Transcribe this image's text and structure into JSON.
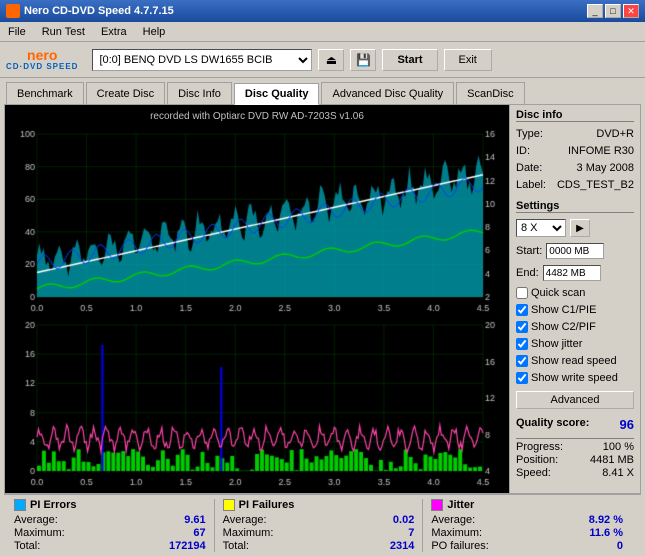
{
  "titlebar": {
    "title": "Nero CD-DVD Speed 4.7.7.15",
    "buttons": [
      "_",
      "□",
      "✕"
    ]
  },
  "menubar": {
    "items": [
      "File",
      "Run Test",
      "Extra",
      "Help"
    ]
  },
  "toolbar": {
    "logo_nero": "nero",
    "logo_sub": "CD·DVD SPEED",
    "drive_label": "[0:0]  BENQ DVD LS DW1655 BCIB",
    "start_label": "Start",
    "exit_label": "Exit"
  },
  "tabs": {
    "items": [
      "Benchmark",
      "Create Disc",
      "Disc Info",
      "Disc Quality",
      "Advanced Disc Quality",
      "ScanDisc"
    ],
    "active": "Disc Quality"
  },
  "chart": {
    "recorded_label": "recorded with Optiarc DVD RW AD-7203S v1.06",
    "top_y_max": "100",
    "top_y_mid": "80",
    "top_y_60": "60",
    "top_y_40": "40",
    "top_y_20": "20",
    "bottom_y_20": "20",
    "bottom_y_16": "16",
    "bottom_y_12": "12",
    "bottom_y_8": "8",
    "bottom_y_4": "4",
    "x_labels": [
      "0.0",
      "0.5",
      "1.0",
      "1.5",
      "2.0",
      "2.5",
      "3.0",
      "3.5",
      "4.0",
      "4.5"
    ],
    "right_y_top": [
      "16",
      "14",
      "12",
      "10",
      "8",
      "6",
      "4",
      "2"
    ],
    "right_y_bottom": [
      "20",
      "16",
      "12",
      "8",
      "4"
    ]
  },
  "disc_info": {
    "section_title": "Disc info",
    "type_label": "Type:",
    "type_value": "DVD+R",
    "id_label": "ID:",
    "id_value": "INFOME R30",
    "date_label": "Date:",
    "date_value": "3 May 2008",
    "label_label": "Label:",
    "label_value": "CDS_TEST_B2"
  },
  "settings": {
    "section_title": "Settings",
    "speed_value": "8 X",
    "start_label": "Start:",
    "start_value": "0000 MB",
    "end_label": "End:",
    "end_value": "4482 MB"
  },
  "checkboxes": {
    "quick_scan": {
      "label": "Quick scan",
      "checked": false
    },
    "show_c1pie": {
      "label": "Show C1/PIE",
      "checked": true
    },
    "show_c2pif": {
      "label": "Show C2/PIF",
      "checked": true
    },
    "show_jitter": {
      "label": "Show jitter",
      "checked": true
    },
    "show_read_speed": {
      "label": "Show read speed",
      "checked": true
    },
    "show_write_speed": {
      "label": "Show write speed",
      "checked": true
    }
  },
  "advanced_btn": "Advanced",
  "quality": {
    "label": "Quality score:",
    "value": "96"
  },
  "progress": {
    "label": "Progress:",
    "value": "100 %",
    "position_label": "Position:",
    "position_value": "4481 MB",
    "speed_label": "Speed:",
    "speed_value": "8.41 X"
  },
  "stats": {
    "pi_errors": {
      "color": "#00aaff",
      "label": "PI Errors",
      "avg_label": "Average:",
      "avg_value": "9.61",
      "max_label": "Maximum:",
      "max_value": "67",
      "total_label": "Total:",
      "total_value": "172194"
    },
    "pi_failures": {
      "color": "#ffff00",
      "label": "PI Failures",
      "avg_label": "Average:",
      "avg_value": "0.02",
      "max_label": "Maximum:",
      "max_value": "7",
      "total_label": "Total:",
      "total_value": "2314"
    },
    "jitter": {
      "color": "#ff00ff",
      "label": "Jitter",
      "avg_label": "Average:",
      "avg_value": "8.92 %",
      "max_label": "Maximum:",
      "max_value": "11.6 %",
      "po_label": "PO failures:",
      "po_value": "0"
    }
  }
}
